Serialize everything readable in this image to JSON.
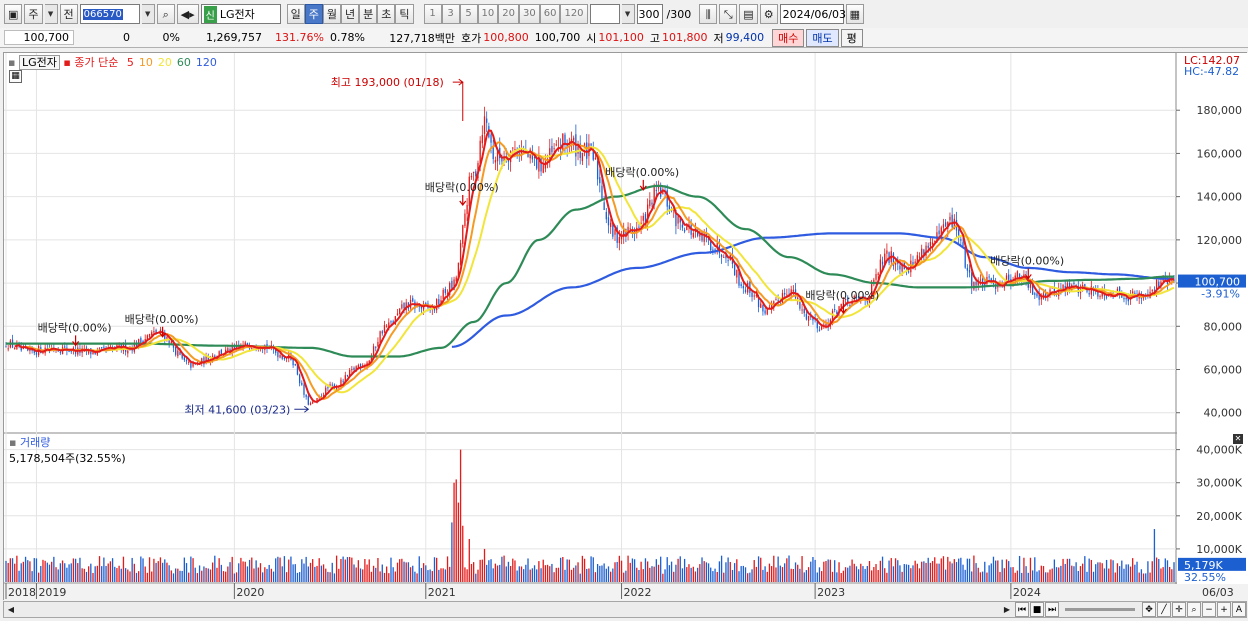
{
  "toolbar": {
    "period_ju": "주",
    "jeon": "전",
    "code": "066570",
    "name": "LG전자",
    "sin": "신",
    "periods": [
      {
        "label": "일",
        "active": false
      },
      {
        "label": "주",
        "active": true
      },
      {
        "label": "월",
        "active": false
      },
      {
        "label": "년",
        "active": false
      },
      {
        "label": "분",
        "active": false
      },
      {
        "label": "초",
        "active": false
      },
      {
        "label": "틱",
        "active": false
      }
    ],
    "intervals": [
      "1",
      "3",
      "5",
      "10",
      "20",
      "30",
      "60",
      "120"
    ],
    "count": "300",
    "count_total": "/300",
    "date": "2024/06/03"
  },
  "quote": {
    "price": "100,700",
    "change": "0",
    "change_pct": "0%",
    "volume": "1,269,757",
    "vol_ratio": "131.76%",
    "turnover_pct": "0.78%",
    "amount": "127,718백만",
    "ask_label": "호가",
    "ask": "100,800",
    "bid": "100,700",
    "open_label": "시",
    "open": "101,100",
    "high_label": "고",
    "high": "101,800",
    "low_label": "저",
    "low": "99,400",
    "buy": "매수",
    "sell": "매도",
    "eval": "평"
  },
  "legend": {
    "stock": "LG전자",
    "ma_title": "종가 단순",
    "mas": [
      {
        "label": "5",
        "color": "#e21b1b"
      },
      {
        "label": "10",
        "color": "#f59a23"
      },
      {
        "label": "20",
        "color": "#f2e53a"
      },
      {
        "label": "60",
        "color": "#2e8b57"
      },
      {
        "label": "120",
        "color": "#2f5be0"
      }
    ]
  },
  "right_labels": {
    "lc": "LC:142.07",
    "hc": "HC:-47.82",
    "current": "100,700",
    "current_pct": "-3.91%",
    "vol_current": "5,179K",
    "vol_pct": "32.55%"
  },
  "annotations": {
    "high": "최고 193,000 (01/18)",
    "low": "최저 41,600 (03/23)",
    "div": [
      "배당락(0.00%)",
      "배당락(0.00%)",
      "배당락(0.00%)",
      "배당락(0.00%)",
      "배당락(0.00%)",
      "배당락(0.00%)"
    ]
  },
  "volume_panel": {
    "title": "거래량",
    "value": "5,178,504주(32.55%)"
  },
  "chart_data": {
    "type": "line",
    "title": "",
    "price_axis": {
      "ylim": [
        32000,
        200000
      ],
      "ticks": [
        40000,
        60000,
        80000,
        100000,
        120000,
        140000,
        160000,
        180000
      ],
      "tick_labels": [
        "40,000",
        "60,000",
        "80,000",
        "100,000",
        "120,000",
        "140,000",
        "160,000",
        "180,000"
      ]
    },
    "volume_axis": {
      "ylim": [
        0,
        42000
      ],
      "ticks": [
        10000,
        20000,
        30000,
        40000
      ],
      "tick_labels": [
        "10,000K",
        "20,000K",
        "30,000K",
        "40,000K"
      ]
    },
    "x_labels": [
      "2018",
      "2019",
      "2020",
      "2021",
      "2022",
      "2023",
      "2024",
      "06/03"
    ],
    "x_label_weeks": [
      0,
      14,
      105,
      193,
      283,
      372,
      462,
      534
    ],
    "weeks_total": 537,
    "close_keypoints": [
      [
        0,
        72000
      ],
      [
        10,
        68000
      ],
      [
        20,
        70000
      ],
      [
        40,
        68000
      ],
      [
        55,
        70000
      ],
      [
        70,
        77000
      ],
      [
        85,
        62000
      ],
      [
        100,
        68000
      ],
      [
        115,
        72000
      ],
      [
        130,
        66000
      ],
      [
        140,
        44000
      ],
      [
        150,
        52000
      ],
      [
        165,
        63000
      ],
      [
        175,
        80000
      ],
      [
        185,
        90000
      ],
      [
        195,
        88000
      ],
      [
        205,
        98000
      ],
      [
        215,
        150000
      ],
      [
        220,
        175000
      ],
      [
        225,
        158000
      ],
      [
        235,
        162000
      ],
      [
        245,
        155000
      ],
      [
        258,
        165000
      ],
      [
        268,
        160000
      ],
      [
        280,
        122000
      ],
      [
        290,
        125000
      ],
      [
        300,
        142000
      ],
      [
        310,
        128000
      ],
      [
        320,
        120000
      ],
      [
        330,
        115000
      ],
      [
        340,
        98000
      ],
      [
        350,
        87000
      ],
      [
        360,
        97000
      ],
      [
        368,
        85000
      ],
      [
        375,
        80000
      ],
      [
        385,
        90000
      ],
      [
        395,
        93000
      ],
      [
        405,
        112000
      ],
      [
        415,
        108000
      ],
      [
        425,
        118000
      ],
      [
        435,
        128000
      ],
      [
        445,
        100000
      ],
      [
        455,
        100000
      ],
      [
        465,
        103000
      ],
      [
        475,
        95000
      ],
      [
        490,
        98000
      ],
      [
        505,
        96000
      ],
      [
        520,
        94000
      ],
      [
        534,
        101000
      ]
    ],
    "ma_60_keypoints": [
      [
        0,
        72000
      ],
      [
        60,
        72000
      ],
      [
        100,
        71000
      ],
      [
        140,
        70000
      ],
      [
        160,
        66000
      ],
      [
        180,
        66000
      ],
      [
        200,
        70000
      ],
      [
        215,
        82000
      ],
      [
        230,
        100000
      ],
      [
        245,
        120000
      ],
      [
        262,
        134000
      ],
      [
        280,
        140000
      ],
      [
        300,
        145000
      ],
      [
        318,
        140000
      ],
      [
        340,
        125000
      ],
      [
        360,
        112000
      ],
      [
        380,
        104000
      ],
      [
        400,
        100000
      ],
      [
        420,
        98000
      ],
      [
        440,
        98000
      ],
      [
        460,
        99000
      ],
      [
        480,
        101000
      ],
      [
        500,
        101500
      ],
      [
        520,
        102000
      ],
      [
        534,
        103000
      ]
    ],
    "ma_120_keypoints": [
      [
        205,
        70500
      ],
      [
        230,
        85000
      ],
      [
        260,
        98000
      ],
      [
        290,
        107000
      ],
      [
        320,
        114000
      ],
      [
        350,
        121000
      ],
      [
        380,
        123000
      ],
      [
        410,
        123000
      ],
      [
        430,
        121000
      ],
      [
        450,
        112000
      ],
      [
        470,
        107000
      ],
      [
        490,
        105000
      ],
      [
        510,
        104000
      ],
      [
        534,
        102000
      ]
    ],
    "volume_bursts": [
      [
        205,
        18000
      ],
      [
        206,
        30000
      ],
      [
        207,
        31000
      ],
      [
        208,
        24000
      ],
      [
        209,
        40000
      ],
      [
        210,
        17000
      ],
      [
        213,
        13000
      ],
      [
        220,
        10000
      ],
      [
        360,
        8000
      ],
      [
        528,
        16000
      ]
    ],
    "events": {
      "high": {
        "week": 210,
        "value": 193000
      },
      "low": {
        "week": 139,
        "value": 41600
      }
    },
    "dividends": [
      {
        "week": 32,
        "value": 73000
      },
      {
        "week": 72,
        "value": 77000
      },
      {
        "week": 210,
        "value": 138000
      },
      {
        "week": 293,
        "value": 145000
      },
      {
        "week": 385,
        "value": 88000
      },
      {
        "week": 470,
        "value": 104000
      }
    ]
  }
}
